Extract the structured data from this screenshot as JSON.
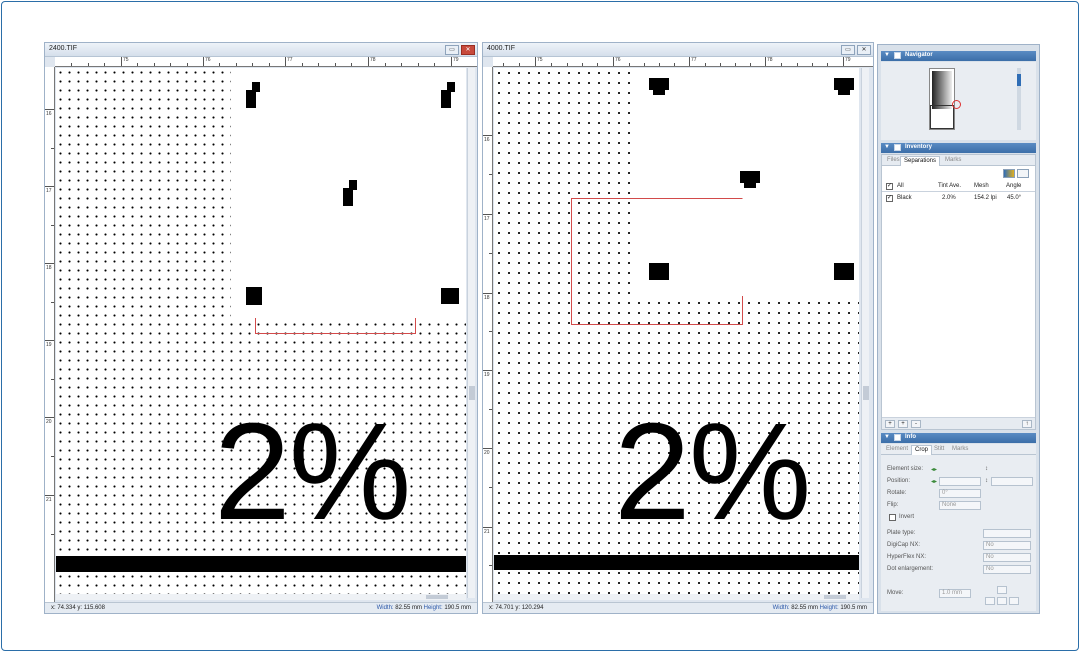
{
  "windows": [
    {
      "title": "2400.TIF",
      "ruler_top": [
        "75",
        "76",
        "77",
        "78",
        "79"
      ],
      "ruler_left": [
        "16",
        "17",
        "18",
        "19",
        "20",
        "21"
      ],
      "big_label": "2%",
      "status": {
        "x_label": "x:",
        "x": "74.334",
        "y_label": "y:",
        "y": "115.608",
        "width_label": "Width:",
        "width": "82.55 mm",
        "height_label": "Height:",
        "height": "190.5 mm"
      }
    },
    {
      "title": "4000.TIF",
      "ruler_top": [
        "75",
        "76",
        "77",
        "78",
        "79"
      ],
      "ruler_left": [
        "16",
        "17",
        "18",
        "19",
        "20",
        "21"
      ],
      "big_label": "2%",
      "status": {
        "x_label": "x:",
        "x": "74.701",
        "y_label": "y:",
        "y": "120.294",
        "width_label": "Width:",
        "width": "82.55 mm",
        "height_label": "Height:",
        "height": "190.5 mm"
      }
    }
  ],
  "panel": {
    "navigator": {
      "title": "Navigator"
    },
    "inventory": {
      "title": "Inventory",
      "tabs": [
        "Files",
        "Separations",
        "Marks"
      ],
      "active_tab": "Separations",
      "columns": {
        "all": "All",
        "tint": "Tint Ave.",
        "mesh": "Mesh",
        "angle": "Angle"
      },
      "rows": [
        {
          "name": "Black",
          "tint": "2.0%",
          "mesh": "154.2 lpi",
          "angle": "45.0°",
          "checked": true
        }
      ],
      "footer_buttons": [
        "+",
        "+",
        "-",
        "↑"
      ]
    },
    "info": {
      "title": "Info",
      "tabs": [
        "Element",
        "Crop",
        "Stitt",
        "Marks"
      ],
      "active_tab": "Crop",
      "labels": {
        "element_size": "Element size:",
        "position": "Position:",
        "rotate": "Rotate:",
        "flip": "Flip:",
        "invert": "Invert",
        "plate_type": "Plate type:",
        "digicap": "DigiCap NX:",
        "hyperflex": "HyperFlex NX:",
        "dot_enlargement": "Dot enlargement:",
        "move": "Move:"
      },
      "values": {
        "rotate": "0°",
        "flip": "None",
        "digicap": "No",
        "hyperflex": "No",
        "dot_enlargement": "No",
        "move": "1.0 mm"
      }
    }
  },
  "colors": {
    "accent": "#3b6ea8",
    "crop_bracket": "#d24a4a",
    "frame": "#2b6ea8"
  }
}
